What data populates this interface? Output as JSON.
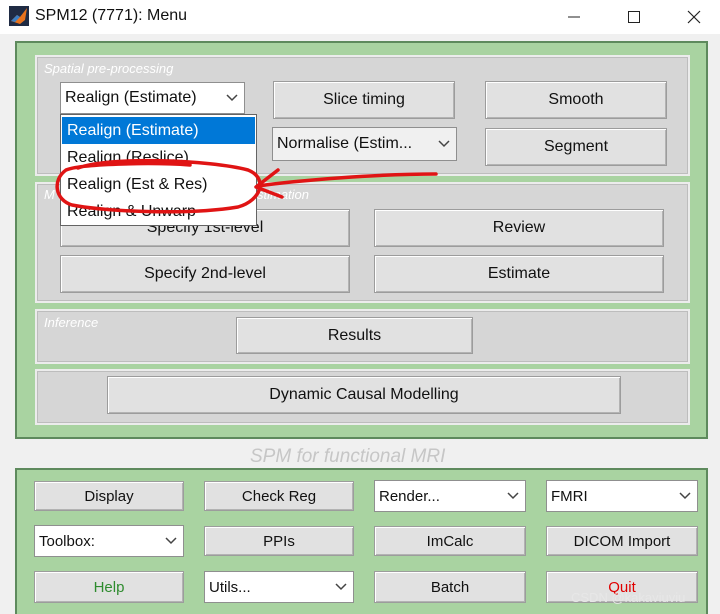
{
  "window": {
    "title": "SPM12 (7771): Menu",
    "controls": {
      "minimize": "—",
      "maximize": "☐",
      "close": "✕"
    }
  },
  "spatial": {
    "label": "Spatial pre-processing",
    "realign_select": {
      "value": "Realign (Estimate)"
    },
    "realign_options": [
      "Realign (Estimate)",
      "Realign (Reslice)",
      "Realign (Est & Res)",
      "Realign & Unwarp"
    ],
    "slice_timing": "Slice timing",
    "smooth": "Smooth",
    "normalise_select": {
      "value": "Normalise (Estim..."
    },
    "segment": "Segment"
  },
  "model": {
    "label_visible": "M",
    "label_tail": "stimation",
    "specify_1st": "Specify 1st-level",
    "review": "Review",
    "specify_2nd": "Specify 2nd-level",
    "estimate": "Estimate"
  },
  "inference": {
    "label": "Inference",
    "results": "Results"
  },
  "dcm": {
    "label": "Dynamic Causal Modelling"
  },
  "caption": "SPM for functional MRI",
  "tools": {
    "display": "Display",
    "check_reg": "Check Reg",
    "render_select": "Render...",
    "modality_select": "FMRI",
    "toolbox_select": "Toolbox:",
    "ppis": "PPIs",
    "imcalc": "ImCalc",
    "dicom_import": "DICOM Import",
    "help": "Help",
    "utils_select": "Utils...",
    "batch": "Batch",
    "quit": "Quit"
  },
  "colors": {
    "panel_green": "#a9d3a1",
    "help_text": "#2e8b2e",
    "quit_text": "#e00000",
    "selection_blue": "#0078d7",
    "annotation_red": "#e01414"
  },
  "watermark": "CSDN @kakaviuviu"
}
